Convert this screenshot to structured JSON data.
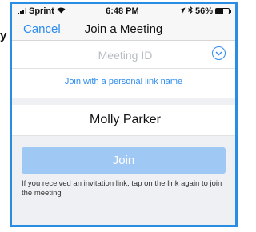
{
  "status_bar": {
    "carrier": "Sprint",
    "time": "6:48 PM",
    "battery": "56%",
    "battery_level": 0.56
  },
  "nav": {
    "cancel_label": "Cancel",
    "title": "Join a Meeting"
  },
  "meeting_id": {
    "placeholder": "Meeting ID",
    "value": ""
  },
  "personal_link_label": "Join with a personal link name",
  "name_field": {
    "value": "Molly Parker"
  },
  "join_button_label": "Join",
  "help_text": "If you received an invitation link, tap on the link again to join the meeting",
  "colors": {
    "accent": "#2d8cf0",
    "join_disabled": "#9fc8f4",
    "frame": "#2a8de4"
  }
}
